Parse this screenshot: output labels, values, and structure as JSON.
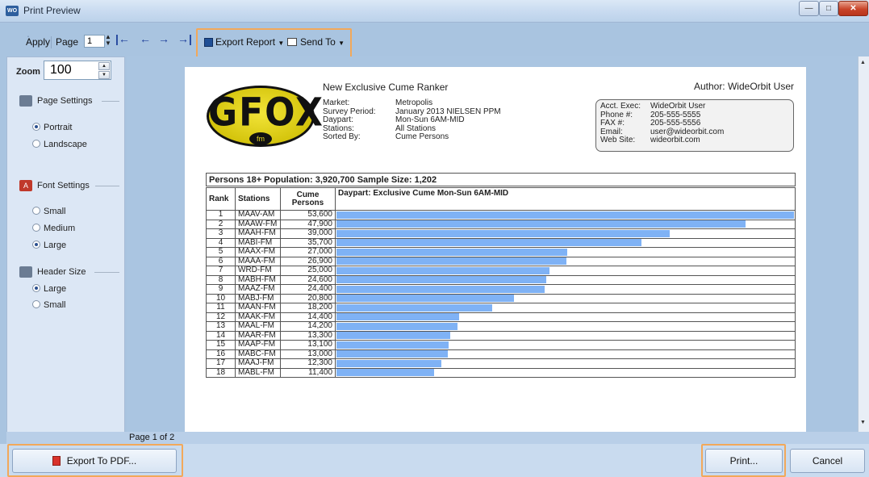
{
  "window": {
    "title": "Print Preview",
    "app_badge": "WO"
  },
  "toolbar": {
    "apply": "Apply",
    "page_label": "Page",
    "page_value": "1",
    "export_report": "Export Report",
    "send_to": "Send To"
  },
  "sidebar": {
    "zoom_label": "Zoom",
    "zoom_value": "100",
    "page_settings": "Page Settings",
    "portrait": "Portrait",
    "landscape": "Landscape",
    "font_settings": "Font Settings",
    "small": "Small",
    "medium": "Medium",
    "large": "Large",
    "header_size": "Header Size",
    "header_large": "Large",
    "header_small": "Small"
  },
  "report": {
    "title": "New Exclusive Cume Ranker",
    "author": "Author: WideOrbit User",
    "logo_text": "GFOX",
    "logo_sub": "fm",
    "meta_labels": [
      "Market:",
      "Survey Period:",
      "Daypart:",
      "Stations:",
      "Sorted By:"
    ],
    "meta_values": [
      "Metropolis",
      "January 2013 NIELSEN PPM",
      "Mon-Sun 6AM-MID",
      "All Stations",
      "Cume Persons"
    ],
    "contact_labels": [
      "Acct. Exec:",
      "Phone #:",
      "FAX #:",
      "Email:",
      "Web Site:"
    ],
    "contact_values": [
      "WideOrbit User",
      "205-555-5555",
      "205-555-5556",
      "user@wideorbit.com",
      "wideorbit.com"
    ],
    "population_line": "Persons 18+    Population: 3,920,700    Sample Size: 1,202",
    "col_rank": "Rank",
    "col_stations": "Stations",
    "col_cume": "Cume Persons",
    "col_daypart": "Daypart: Exclusive Cume Mon-Sun 6AM-MID"
  },
  "chart_data": {
    "type": "bar",
    "categories": [
      "MAAV-AM",
      "MAAW-FM",
      "MAAH-FM",
      "MABI-FM",
      "MAAX-FM",
      "MAAA-FM",
      "WRD-FM",
      "MABH-FM",
      "MAAZ-FM",
      "MABJ-FM",
      "MAAN-FM",
      "MAAK-FM",
      "MAAL-FM",
      "MAAR-FM",
      "MAAP-FM",
      "MABC-FM",
      "MAAJ-FM",
      "MABL-FM"
    ],
    "ranks": [
      "1",
      "2",
      "3",
      "4",
      "5",
      "6",
      "7",
      "8",
      "9",
      "10",
      "11",
      "12",
      "13",
      "14",
      "15",
      "16",
      "17",
      "18"
    ],
    "labels": [
      "53,600",
      "47,900",
      "39,000",
      "35,700",
      "27,000",
      "26,900",
      "25,000",
      "24,600",
      "24,400",
      "20,800",
      "18,200",
      "14,400",
      "14,200",
      "13,300",
      "13,100",
      "13,000",
      "12,300",
      "11,400"
    ],
    "values": [
      53600,
      47900,
      39000,
      35700,
      27000,
      26900,
      25000,
      24600,
      24400,
      20800,
      18200,
      14400,
      14200,
      13300,
      13100,
      13000,
      12300,
      11400
    ],
    "color": "#7fb2f5"
  },
  "status": {
    "page_indicator": "Page 1 of 2"
  },
  "buttons": {
    "export_pdf": "Export To PDF...",
    "print": "Print...",
    "cancel": "Cancel"
  }
}
